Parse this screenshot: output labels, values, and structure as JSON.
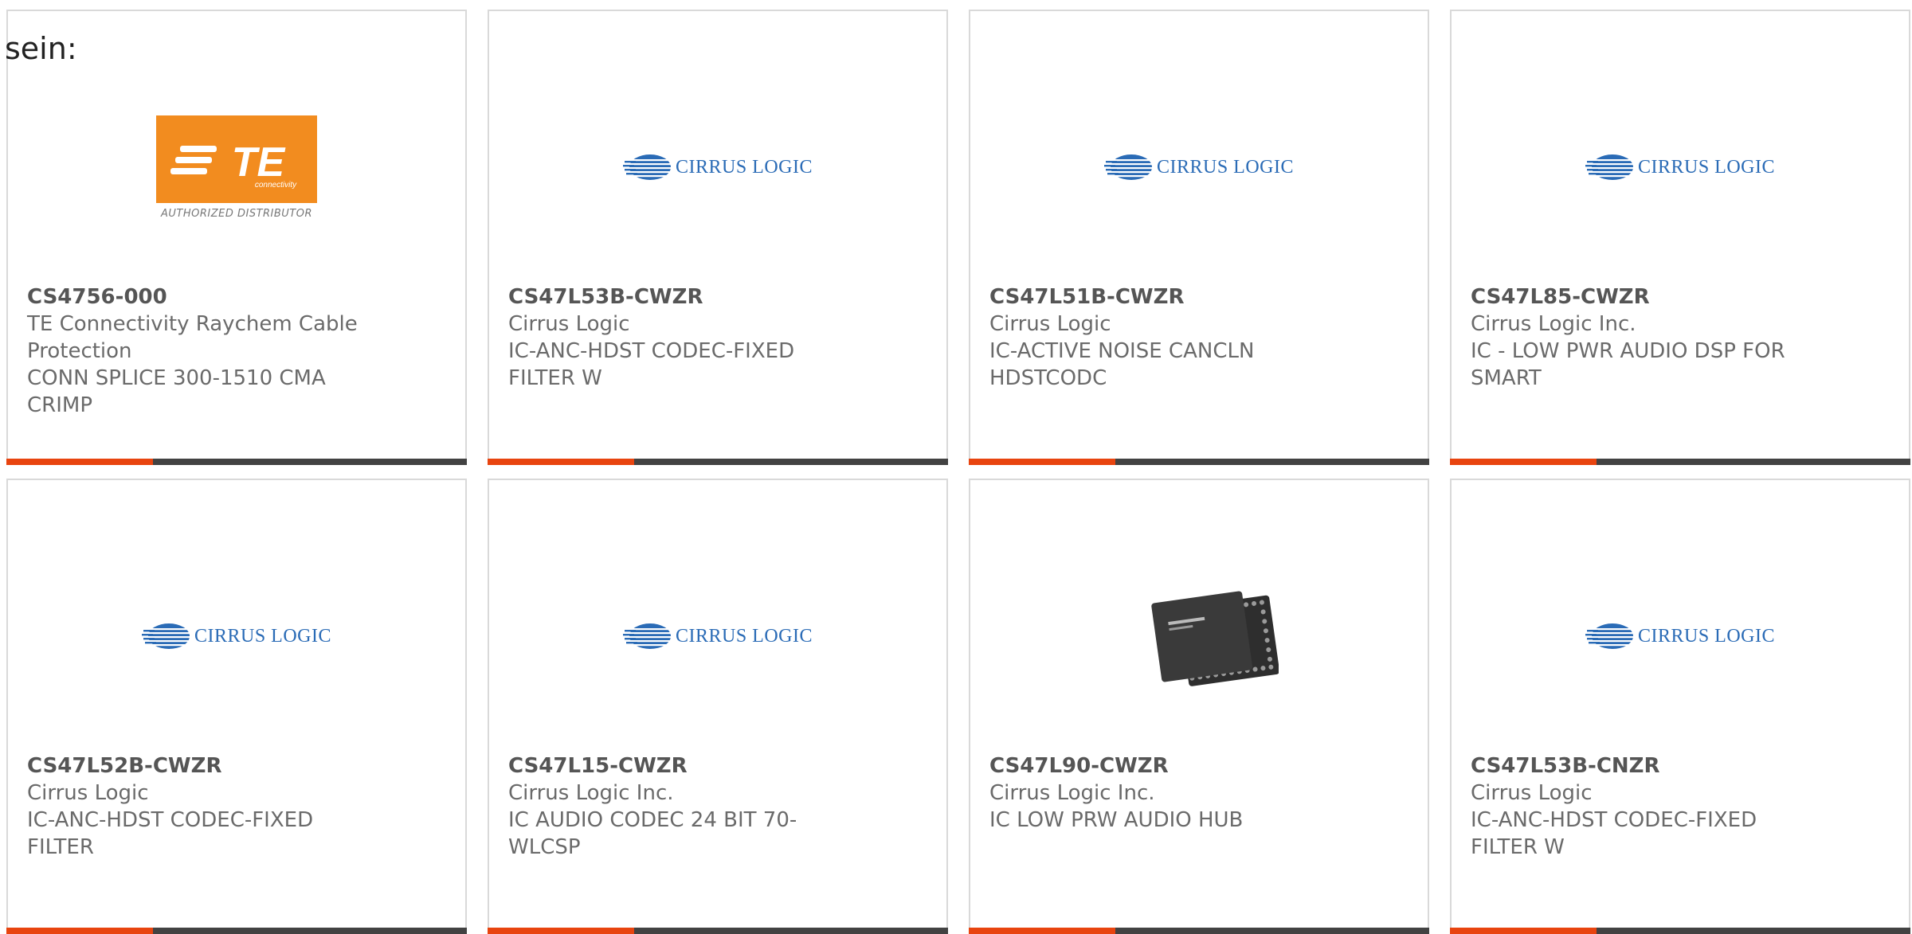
{
  "intro_text": "sein:",
  "colors": {
    "accent_bar": "#e8440f",
    "rest_bar": "#424242",
    "card_border": "#d9d9d9",
    "te_orange": "#f28c1f",
    "cirrus_blue": "#2a6bb6"
  },
  "te_logo": {
    "subtitle": "AUTHORIZED DISTRIBUTOR",
    "word": "TE",
    "small": "connectivity"
  },
  "cirrus_logo": {
    "text": "CIRRUS LOGIC"
  },
  "products": [
    {
      "part_number": "CS4756-000",
      "manufacturer": "TE Connectivity Raychem Cable Protection",
      "description": "CONN SPLICE 300-1510 CMA CRIMP",
      "logo": "te-connectivity-logo"
    },
    {
      "part_number": "CS47L53B-CWZR",
      "manufacturer": "Cirrus Logic",
      "description": "IC-ANC-HDST CODEC-FIXED FILTER W",
      "logo": "cirrus-logic-logo"
    },
    {
      "part_number": "CS47L51B-CWZR",
      "manufacturer": "Cirrus Logic",
      "description": "IC-ACTIVE NOISE CANCLN HDSTCODC",
      "logo": "cirrus-logic-logo"
    },
    {
      "part_number": "CS47L85-CWZR",
      "manufacturer": "Cirrus Logic Inc.",
      "description": "IC - LOW PWR AUDIO DSP FOR SMART",
      "logo": "cirrus-logic-logo"
    },
    {
      "part_number": "CS47L52B-CWZR",
      "manufacturer": "Cirrus Logic",
      "description": "IC-ANC-HDST CODEC-FIXED FILTER",
      "logo": "cirrus-logic-logo"
    },
    {
      "part_number": "CS47L15-CWZR",
      "manufacturer": "Cirrus Logic Inc.",
      "description": "IC AUDIO CODEC 24 BIT 70-WLCSP",
      "logo": "cirrus-logic-logo"
    },
    {
      "part_number": "CS47L90-CWZR",
      "manufacturer": "Cirrus Logic Inc.",
      "description": "IC LOW PRW AUDIO HUB",
      "logo": "chip-photo"
    },
    {
      "part_number": "CS47L53B-CNZR",
      "manufacturer": "Cirrus Logic",
      "description": "IC-ANC-HDST CODEC-FIXED FILTER W",
      "logo": "cirrus-logic-logo"
    }
  ]
}
